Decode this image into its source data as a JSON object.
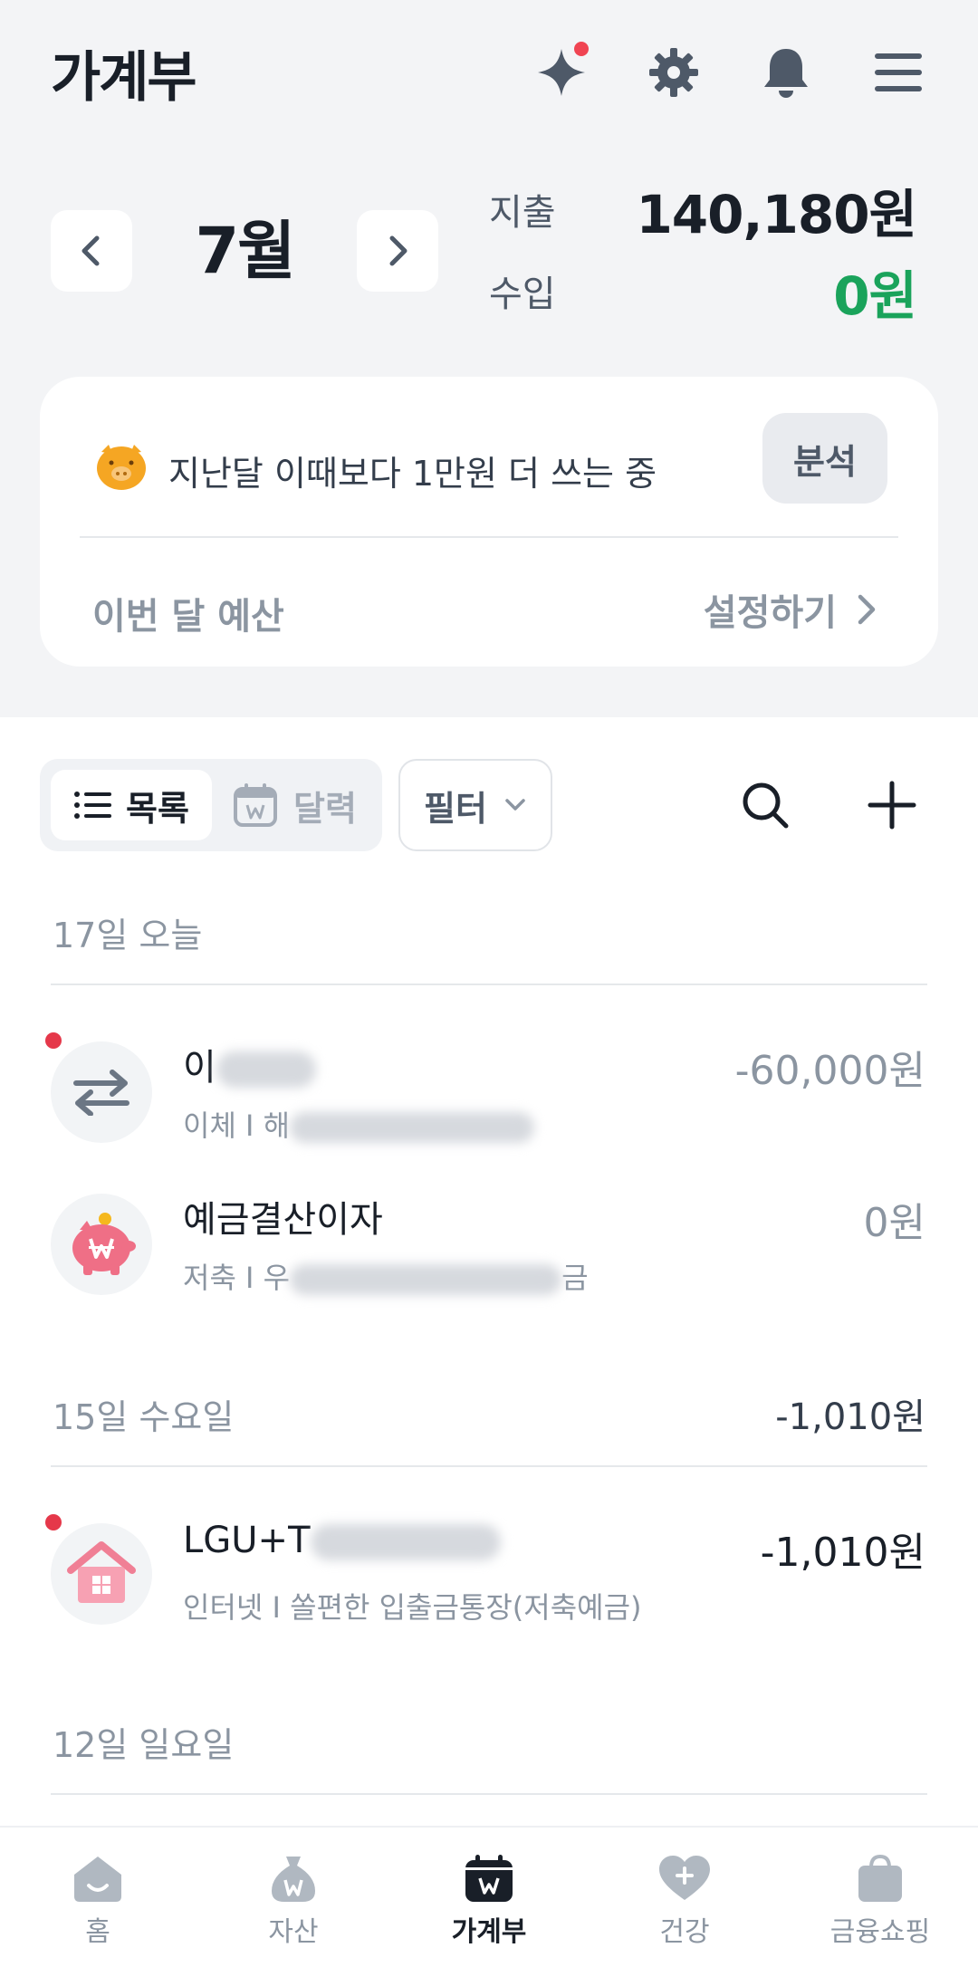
{
  "header": {
    "title": "가계부",
    "icons": [
      "sparkle-icon",
      "gear-icon",
      "bell-icon",
      "menu-icon"
    ]
  },
  "summary": {
    "month": "7월",
    "expense_label": "지출",
    "expense_value": "140,180원",
    "income_label": "수입",
    "income_value": "0원",
    "income_color": "#1aa35b"
  },
  "insight": {
    "message": "지난달 이때보다 1만원 더 쓰는 중",
    "analyze_label": "분석",
    "budget_label": "이번 달 예산",
    "budget_action": "설정하기"
  },
  "toolbar": {
    "list_label": "목록",
    "calendar_label": "달력",
    "filter_label": "필터"
  },
  "groups": [
    {
      "date": "17일 오늘",
      "total": "",
      "items": [
        {
          "title_visible": "이",
          "sub_visible": "이체 I 해",
          "amount": "-60,000원",
          "icon": "transfer-icon",
          "unread": true
        },
        {
          "title_visible": "예금결산이자",
          "sub_visible": "저축 I 우",
          "sub_tail": "금",
          "amount": "0원",
          "icon": "piggy-bank-icon",
          "unread": false
        }
      ]
    },
    {
      "date": "15일 수요일",
      "total": "-1,010원",
      "items": [
        {
          "title_visible": "LGU+T",
          "sub_visible": "인터넷 I 쏠편한 입출금통장(저축예금)",
          "amount": "-1,010원",
          "icon": "house-icon",
          "unread": true
        }
      ]
    },
    {
      "date": "12일 일요일",
      "total": "",
      "items": []
    }
  ],
  "bottom_nav": [
    {
      "label": "홈",
      "icon": "home-icon"
    },
    {
      "label": "자산",
      "icon": "money-bag-icon"
    },
    {
      "label": "가계부",
      "icon": "calendar-book-icon",
      "active": true
    },
    {
      "label": "건강",
      "icon": "heart-plus-icon"
    },
    {
      "label": "금융쇼핑",
      "icon": "shopping-bag-icon"
    }
  ]
}
